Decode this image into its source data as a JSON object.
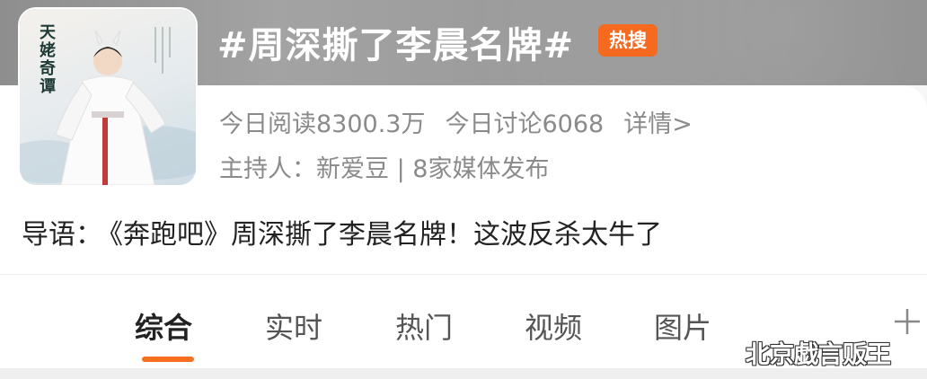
{
  "topic": {
    "title": "#周深撕了李晨名牌#",
    "badge": "热搜",
    "badge_color": "#f56a1e"
  },
  "thumbnail": {
    "poster_text": "天姥奇谭",
    "icon": "poster-image"
  },
  "stats": {
    "reads": "今日阅读8300.3万",
    "discussions": "今日讨论6068",
    "details_link": "详情>"
  },
  "host": {
    "text": "主持人：新爱豆 | 8家媒体发布"
  },
  "intro": {
    "label": "导语：",
    "text": "《奔跑吧》周深撕了李晨名牌！这波反杀太牛了"
  },
  "tabs": [
    {
      "label": "综合",
      "active": true
    },
    {
      "label": "实时",
      "active": false
    },
    {
      "label": "热门",
      "active": false
    },
    {
      "label": "视频",
      "active": false
    },
    {
      "label": "图片",
      "active": false
    }
  ],
  "accent_color": "#f7701f",
  "watermark": "北京戯言贩王"
}
